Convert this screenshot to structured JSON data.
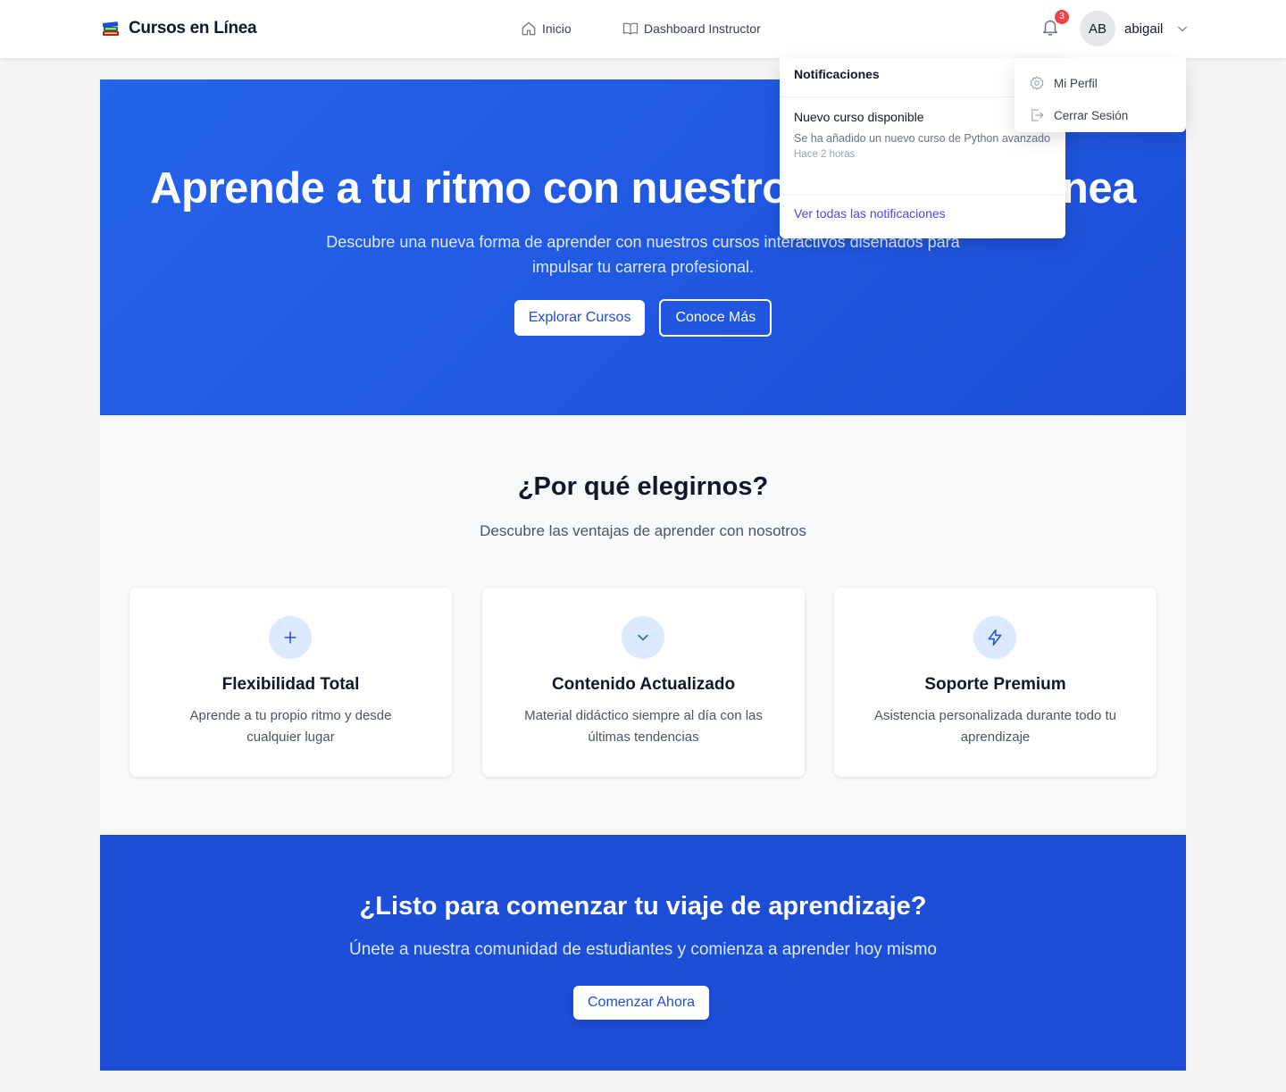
{
  "navbar": {
    "brand": "Cursos en Línea",
    "links": [
      {
        "label": "Inicio",
        "icon": "home-icon"
      },
      {
        "label": "Dashboard Instructor",
        "icon": "book-icon"
      }
    ],
    "notification_count": "3",
    "user": {
      "initials": "AB",
      "name": "abigail"
    }
  },
  "hero": {
    "title": "Aprende a tu ritmo con nuestros cursos en línea",
    "subtitle": "Descubre una nueva forma de aprender con nuestros cursos interactivos diseñados para impulsar tu carrera profesional.",
    "primary_button": "Explorar Cursos",
    "secondary_button": "Conoce Más"
  },
  "features": {
    "title": "¿Por qué elegirnos?",
    "subtitle": "Descubre las ventajas de aprender con nosotros",
    "cards": [
      {
        "icon": "plus-icon",
        "title": "Flexibilidad Total",
        "text": "Aprende a tu propio ritmo y desde cualquier lugar"
      },
      {
        "icon": "chevron-down-icon",
        "title": "Contenido Actualizado",
        "text": "Material didáctico siempre al día con las últimas tendencias"
      },
      {
        "icon": "lightning-icon",
        "title": "Soporte Premium",
        "text": "Asistencia personalizada durante todo tu aprendizaje"
      }
    ]
  },
  "cta": {
    "title": "¿Listo para comenzar tu viaje de aprendizaje?",
    "subtitle": "Únete a nuestra comunidad de estudiantes y comienza a aprender hoy mismo",
    "button": "Comenzar Ahora"
  },
  "notifications": {
    "header": "Notificaciones",
    "items": [
      {
        "title": "Nuevo curso disponible",
        "message": "Se ha añadido un nuevo curso de Python avanzado",
        "time": "Hace 2 horas"
      }
    ],
    "footer": "Ver todas las notificaciones"
  },
  "user_menu": {
    "items": [
      {
        "label": "Mi Perfil",
        "icon": "gear-icon"
      },
      {
        "label": "Cerrar Sesión",
        "icon": "logout-icon"
      }
    ]
  },
  "colors": {
    "primary": "#2563eb",
    "primary_dark": "#1d4ed8",
    "badge": "#ef4444",
    "link": "#4f46e5"
  }
}
